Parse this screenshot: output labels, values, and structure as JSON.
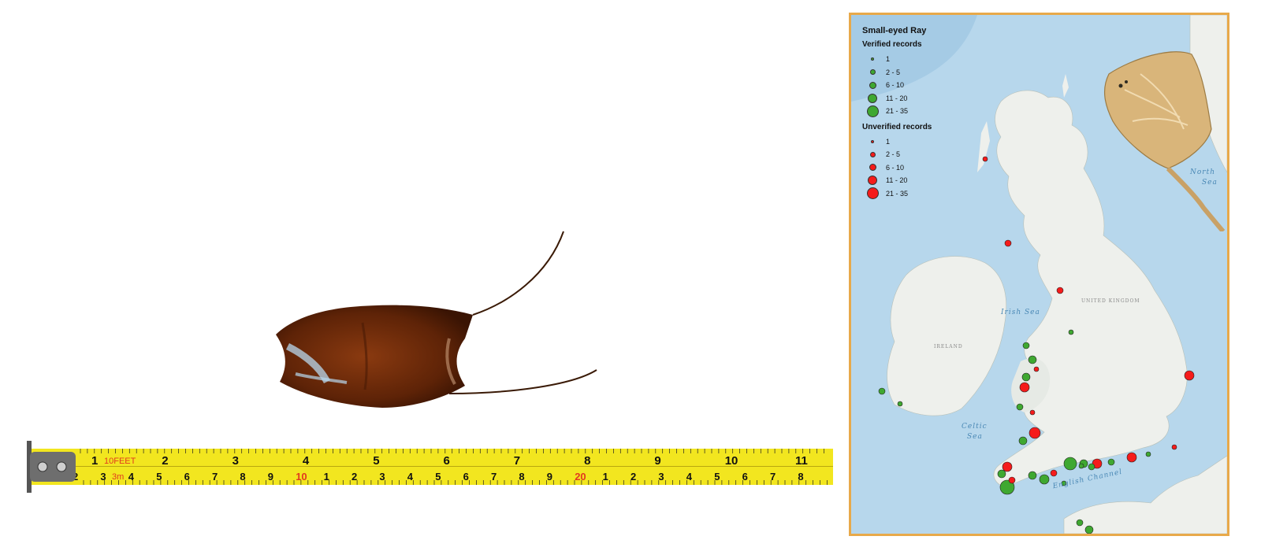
{
  "tape_measure": {
    "top_labels": [
      "1",
      "2",
      "3",
      "4",
      "5",
      "6",
      "7",
      "8",
      "9",
      "10",
      "11"
    ],
    "top_red_text": "10FEET",
    "bottom_labels": [
      "2",
      "3",
      "4",
      "5",
      "6",
      "7",
      "8",
      "9",
      "10",
      "1",
      "2",
      "3",
      "4",
      "5",
      "6",
      "7",
      "8",
      "9",
      "20",
      "1",
      "2",
      "3",
      "4",
      "5",
      "6",
      "7",
      "8"
    ],
    "bottom_red_text": "3m"
  },
  "map": {
    "legend": {
      "title": "Small-eyed Ray",
      "verified_heading": "Verified records",
      "unverified_heading": "Unverified records",
      "classes": [
        "1",
        "2 - 5",
        "6 - 10",
        "11 - 20",
        "21 - 35"
      ],
      "verified_color": "#3fa831",
      "unverified_color": "#f51b1b"
    },
    "sea_labels": {
      "north_sea_1": "North",
      "north_sea_2": "Sea",
      "celtic_sea_1": "Celtic",
      "celtic_sea_2": "Sea",
      "irish_sea": "Irish Sea",
      "english_channel": "English Channel"
    },
    "land_labels": {
      "ireland": "IRELAND",
      "united_kingdom": "UNITED KINGDOM"
    },
    "frame_color": "#e8a94a"
  }
}
